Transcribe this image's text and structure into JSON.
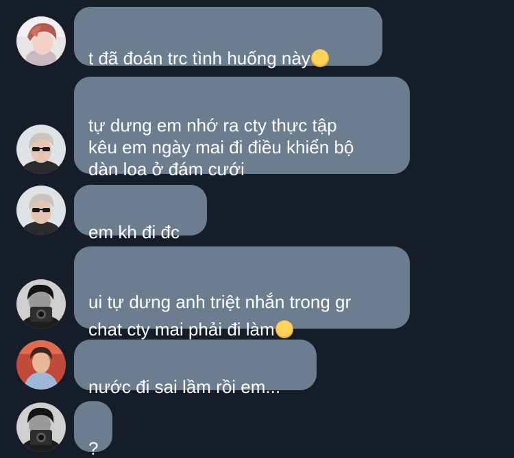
{
  "conversation": {
    "messages": [
      {
        "text": "t đã đoán trc tình huống này",
        "emoji": "smiling-face-with-hearts-emoji",
        "avatar": "avatar-pink-hair"
      },
      {
        "text": "tự dưng em nhớ ra cty thực tập\nkêu em ngày mai đi điều khiển bộ\ndàn loa ở đám cưới",
        "emoji": null,
        "avatar": "avatar-sunglasses"
      },
      {
        "text": "em kh đi đc",
        "emoji": null,
        "avatar": "avatar-sunglasses"
      },
      {
        "text": "ui tự dưng anh triệt nhắn trong gr\nchat cty mai phải đi làm",
        "emoji": "frowning-face-emoji",
        "avatar": "avatar-camera-bw"
      },
      {
        "text": "nước đi sai lầm rồi em...",
        "emoji": null,
        "avatar": "avatar-red-bg"
      },
      {
        "text": "?",
        "emoji": null,
        "avatar": "avatar-camera-bw"
      }
    ]
  },
  "colors": {
    "background": "#151e28",
    "bubble": "#6c7d90",
    "text": "#ffffff"
  }
}
